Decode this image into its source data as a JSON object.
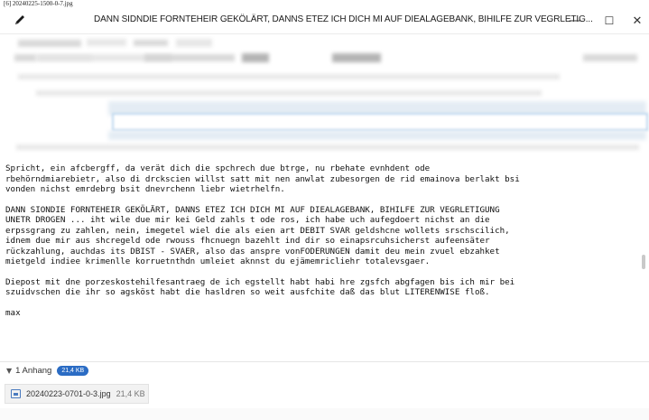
{
  "frame_label": "[6] 20240225-1500-0-7.jpg",
  "window": {
    "title": "DANN SIDNDIE FORNTEHEIR GEKÖLÄRT, DANNS ETEZ ICH DICH MI AUF DIEALAGEBANK, BIHILFE ZUR VEGRLETIG...",
    "minimize_label": "—",
    "maximize_label": "☐",
    "close_label": "✕"
  },
  "message": {
    "paragraphs": [
      "Spricht, ein afcbergff, da verät dich die spchrech due btrge, nu rbehate evnhdent ode\nrbehörndmiarebietr, also di drckscien willst satt mit nen anwlat zubesorgen de rid emainova berlakt bsi\nvonden nichst emrdebrg bsit dnevrchenn liebr wietrhelfn.",
      "DANN SIONDIE FORNTEHEIR GEKÖLÄRT, DANNS ETEZ ICH DICH MI AUF DIEALAGEBANK, BIHILFE ZUR VEGRLETIGUNG\nUNETR DROGEN ... iht wile due mir kei Geld zahls t ode ros, ich habe uch aufegdoert nichst an die\nerpssgrang zu zahlen, nein, imegetel wiel die als eien art DEBIT SVAR geldshcne wollets srschscilich,\nidnem due mir aus shcregeld ode rwouss fhcnuegn bazehlt ind dir so einapsrcuhsicherst aufeensäter\nrückzahlung, auchdas its DBIST - SVAER, also das anspre vonFODERUNGEN damit deu mein zvuel ebzahket\nmietgeld indiee krimenlle korruetnthdn umleiet aknnst du ejämemricliehr totalevsgaer.",
      "Diepost mit dne porzeskostehilfesantraeg de ich egstellt habt habi hre zgsfch abgfagen bis ich mir bei\nszuidvschen die ihr so agsköst habt die hasldren so weit ausfchite daß das blut LITERENWISE floß.",
      "max"
    ]
  },
  "attachments": {
    "toggle_label": "1 Anhang",
    "total_size": "21,4 KB",
    "items": [
      {
        "filename": "20240223-0701-0-3.jpg",
        "size": "21,4 KB"
      }
    ]
  },
  "icons": {
    "edit": "edit-pencil-icon",
    "file": "image-file-icon",
    "toggle": "chevron-down-icon"
  },
  "colors": {
    "badge": "#2b6cc4",
    "field_border": "#bcd6ee"
  }
}
